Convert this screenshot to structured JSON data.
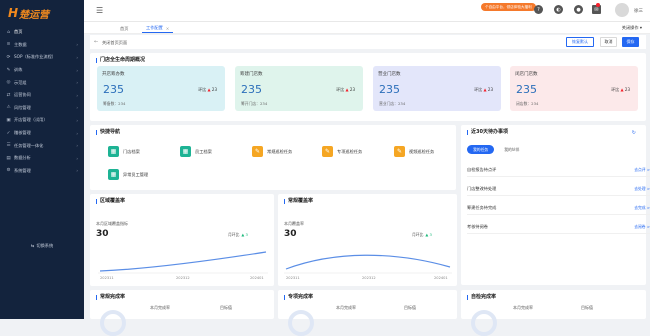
{
  "app": {
    "logo_text": "楚运营"
  },
  "sidebar": {
    "items": [
      {
        "label": "首页",
        "icon": "home-icon",
        "glyph": "⌂",
        "chevron": false
      },
      {
        "label": "主数据",
        "icon": "database-icon",
        "glyph": "≡",
        "chevron": true
      },
      {
        "label": "SOP（标准作业流程）",
        "icon": "flow-icon",
        "glyph": "⟳",
        "chevron": true
      },
      {
        "label": "训练",
        "icon": "training-icon",
        "glyph": "✎",
        "chevron": true
      },
      {
        "label": "示范组",
        "icon": "team-icon",
        "glyph": "◎",
        "chevron": true
      },
      {
        "label": "运营协同",
        "icon": "collab-icon",
        "glyph": "⇄",
        "chevron": true
      },
      {
        "label": "风险管理",
        "icon": "risk-icon",
        "glyph": "⚠",
        "chevron": true
      },
      {
        "label": "开店管理（试用）",
        "icon": "store-icon",
        "glyph": "▣",
        "chevron": true
      },
      {
        "label": "稽核管理",
        "icon": "audit-icon",
        "glyph": "✓",
        "chevron": true
      },
      {
        "label": "任务管理一体化",
        "icon": "task-icon",
        "glyph": "☰",
        "chevron": true
      },
      {
        "label": "数据分析",
        "icon": "chart-icon",
        "glyph": "▤",
        "chevron": true
      },
      {
        "label": "系统管理",
        "icon": "settings-icon",
        "glyph": "⚙",
        "chevron": true
      }
    ],
    "footer": "切换系统"
  },
  "header": {
    "promo": "个自由平台，领店体验大福利",
    "username": "徐三"
  },
  "tabs": {
    "home": "首页",
    "workbench": "工作配置",
    "close_ops": "关闭操作"
  },
  "toolbar": {
    "path": "关闭首页页面",
    "restore": "恢复默认",
    "cancel": "取消",
    "save": "保存"
  },
  "overview": {
    "title": "门店全生命周期概况",
    "cards": [
      {
        "name": "开店筹办数",
        "value": "235",
        "yoy_label": "环比",
        "yoy_value": "23",
        "sub": "筹备数：234",
        "bg": "#d9f1f5"
      },
      {
        "name": "筹建门店数",
        "value": "235",
        "yoy_label": "环比",
        "yoy_value": "23",
        "sub": "筹开门店：234",
        "bg": "#dff4ec"
      },
      {
        "name": "营业门店数",
        "value": "235",
        "yoy_label": "环比",
        "yoy_value": "23",
        "sub": "营业门店：234",
        "bg": "#e3e6fa"
      },
      {
        "name": "闭店门店数",
        "value": "235",
        "yoy_label": "环比",
        "yoy_value": "23",
        "sub": "闭店数：234",
        "bg": "#fce9ea"
      }
    ]
  },
  "quick_nav": {
    "title": "快捷导航",
    "items": [
      {
        "label": "门店档案",
        "color": "#1db394"
      },
      {
        "label": "员工档案",
        "color": "#1db394"
      },
      {
        "label": "常规巡检任务",
        "color": "#f5a623"
      },
      {
        "label": "专项巡检任务",
        "color": "#f5a623"
      },
      {
        "label": "视频巡检任务",
        "color": "#f5a623"
      },
      {
        "label": "异常员工管理",
        "color": "#1db394"
      }
    ]
  },
  "todo": {
    "title": "近30天待办事项",
    "tab_mine": "我的任务",
    "tab_partner": "我的伙伴",
    "rows": [
      {
        "label": "自检报告待点评",
        "go": "去点评 >"
      },
      {
        "label": "门店整改待处理",
        "go": "去处理 >"
      },
      {
        "label": "筹建任务待完成",
        "go": "去完成 >"
      },
      {
        "label": "考核待阅卷",
        "go": "去阅卷 >"
      }
    ]
  },
  "coverage": {
    "title": "区域覆盖率",
    "label": "本月区域覆盖指标",
    "value": "30",
    "yoy_label": "月环比",
    "yoy_value": "3",
    "xticks": [
      "202311",
      "202312",
      "202401"
    ]
  },
  "routine": {
    "title": "常规覆盖率",
    "label": "本月覆盖率",
    "value": "30",
    "yoy_label": "月环比",
    "yoy_value": "3",
    "xticks": [
      "202311",
      "202312",
      "202401"
    ]
  },
  "bottom": {
    "c1": {
      "title": "常规完成率",
      "sub1": "本月完成率",
      "sub2": "目标值"
    },
    "c2": {
      "title": "专项完成率",
      "sub1": "本月完成率",
      "sub2": "目标值"
    },
    "c3": {
      "title": "自检完成率",
      "sub1": "本月完成率",
      "sub2": "目标值"
    }
  }
}
